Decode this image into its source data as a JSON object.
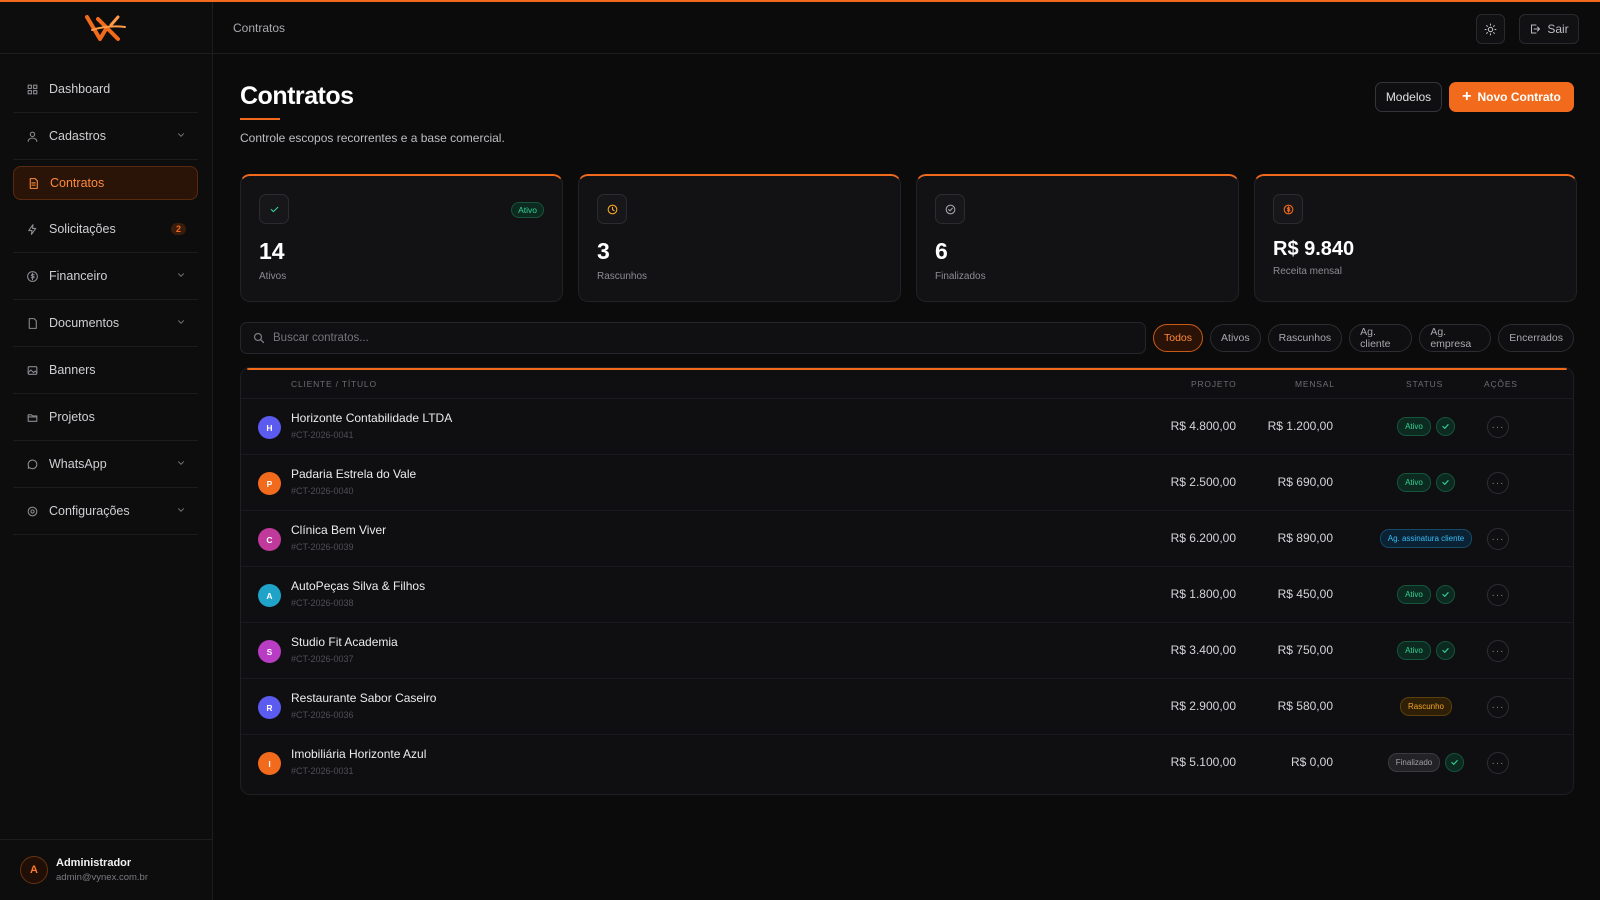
{
  "breadcrumb": "Contratos",
  "header": {
    "logout_label": "Sair"
  },
  "sidebar": {
    "items": [
      {
        "label": "Dashboard",
        "icon": "grid-icon"
      },
      {
        "label": "Cadastros",
        "icon": "users-icon",
        "chevron": true
      },
      {
        "label": "Contratos",
        "icon": "file-icon",
        "active": true
      },
      {
        "label": "Solicitações",
        "icon": "bolt-icon",
        "badge": "2"
      },
      {
        "label": "Financeiro",
        "icon": "dollar-icon",
        "chevron": true
      },
      {
        "label": "Documentos",
        "icon": "document-icon",
        "chevron": true
      },
      {
        "label": "Banners",
        "icon": "image-icon"
      },
      {
        "label": "Projetos",
        "icon": "folder-icon"
      },
      {
        "label": "WhatsApp",
        "icon": "chat-icon",
        "chevron": true
      },
      {
        "label": "Configurações",
        "icon": "gear-icon",
        "chevron": true
      }
    ],
    "user": {
      "initial": "A",
      "name": "Administrador",
      "email": "admin@vynex.com.br"
    }
  },
  "page": {
    "title": "Contratos",
    "subtitle": "Controle escopos recorrentes e a base comercial.",
    "modelos_label": "Modelos",
    "novo_label": "Novo Contrato"
  },
  "stats": [
    {
      "value": "14",
      "label": "Ativos",
      "badge": "Ativo",
      "icon": "check-icon",
      "color": "#34d399"
    },
    {
      "value": "3",
      "label": "Rascunhos",
      "icon": "clock-icon",
      "color": "#f5a524"
    },
    {
      "value": "6",
      "label": "Finalizados",
      "icon": "check-circle-icon",
      "color": "#a1a1a6"
    },
    {
      "value": "R$ 9.840",
      "label": "Receita mensal",
      "icon": "coin-icon",
      "color": "#f26a1b"
    }
  ],
  "search": {
    "placeholder": "Buscar contratos..."
  },
  "filters": [
    "Todos",
    "Ativos",
    "Rascunhos",
    "Ag. cliente",
    "Ag. empresa",
    "Encerrados"
  ],
  "table": {
    "columns": {
      "client": "CLIENTE / TÍTULO",
      "project": "PROJETO",
      "monthly": "MENSAL",
      "status": "STATUS",
      "actions": "AÇÕES"
    },
    "rows": [
      {
        "initial": "H",
        "color": "#5b5bf0",
        "name": "Horizonte Contabilidade LTDA",
        "code": "#CT-2026-0041",
        "project": "R$ 4.800,00",
        "monthly": "R$ 1.200,00",
        "status": "Ativo",
        "kind": "ativo",
        "check": true
      },
      {
        "initial": "P",
        "color": "#f26a1b",
        "name": "Padaria Estrela do Vale",
        "code": "#CT-2026-0040",
        "project": "R$ 2.500,00",
        "monthly": "R$ 690,00",
        "status": "Ativo",
        "kind": "ativo",
        "check": true
      },
      {
        "initial": "C",
        "color": "#c0399b",
        "name": "Clínica Bem Viver",
        "code": "#CT-2026-0039",
        "project": "R$ 6.200,00",
        "monthly": "R$ 890,00",
        "status": "Ag. assinatura cliente",
        "kind": "ag",
        "check": false
      },
      {
        "initial": "A",
        "color": "#1fa3c9",
        "name": "AutoPeças Silva & Filhos",
        "code": "#CT-2026-0038",
        "project": "R$ 1.800,00",
        "monthly": "R$ 450,00",
        "status": "Ativo",
        "kind": "ativo",
        "check": true
      },
      {
        "initial": "S",
        "color": "#b83cc4",
        "name": "Studio Fit Academia",
        "code": "#CT-2026-0037",
        "project": "R$ 3.400,00",
        "monthly": "R$ 750,00",
        "status": "Ativo",
        "kind": "ativo",
        "check": true
      },
      {
        "initial": "R",
        "color": "#5b5bf0",
        "name": "Restaurante Sabor Caseiro",
        "code": "#CT-2026-0036",
        "project": "R$ 2.900,00",
        "monthly": "R$ 580,00",
        "status": "Rascunho",
        "kind": "rasc",
        "check": false
      },
      {
        "initial": "I",
        "color": "#f26a1b",
        "name": "Imobiliária Horizonte Azul",
        "code": "#CT-2026-0031",
        "project": "R$ 5.100,00",
        "monthly": "R$ 0,00",
        "status": "Finalizado",
        "kind": "fin",
        "check": true
      }
    ]
  }
}
